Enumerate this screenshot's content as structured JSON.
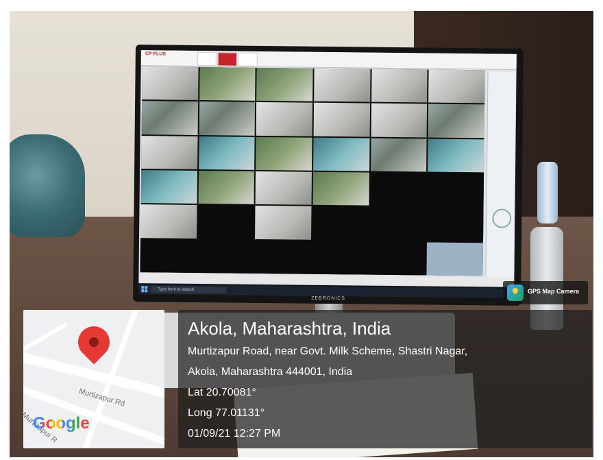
{
  "photo": {
    "monitor_brand": "ZEBRONICS",
    "app_logo": "CP PLUS",
    "taskbar_search_placeholder": "Type here to search"
  },
  "gps_badge": {
    "label": "GPS Map Camera",
    "icon": "gps-map-camera-icon"
  },
  "map": {
    "road_name": "Murtizapur Rd",
    "road_name_2": "Murtizapur R",
    "logo": "Google",
    "pin_icon": "location-pin-icon",
    "pin_color": "#e53935"
  },
  "location": {
    "title": "Akola, Maharashtra, India",
    "address_line1": "Murtizapur Road, near Govt. Milk Scheme, Shastri Nagar,",
    "address_line2": "Akola, Maharashtra 444001, India",
    "lat": "Lat 20.70081°",
    "long": "Long 77.01131°",
    "datetime": "01/09/21 12:27 PM"
  }
}
